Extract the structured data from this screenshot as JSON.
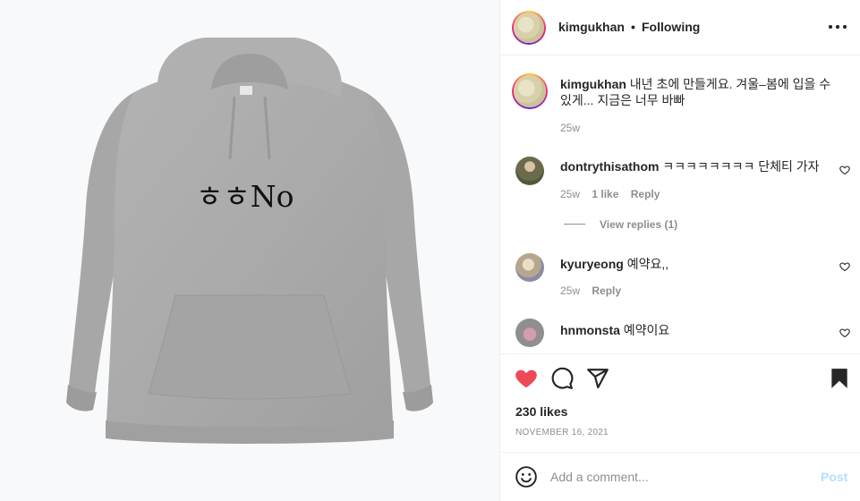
{
  "post": {
    "image_print_text": "ㅎㅎNo",
    "image_alt": "gray-hoodie"
  },
  "header": {
    "username": "kimgukhan",
    "separator": "•",
    "follow_status": "Following",
    "more_icon": "more-horizontal-icon"
  },
  "caption": {
    "username": "kimgukhan",
    "text": "내년 초에 만들게요. 겨울–봄에 입을 수 있게... 지금은 너무 바빠",
    "time": "25w"
  },
  "comments": [
    {
      "username": "dontrythisathom",
      "text": "ㅋㅋㅋㅋㅋㅋㅋㅋ 단체티 가자",
      "time": "25w",
      "likes": "1 like",
      "reply": "Reply",
      "view_replies": "View replies (1)"
    },
    {
      "username": "kyuryeong",
      "text": "예약요,,",
      "time": "25w",
      "reply": "Reply"
    },
    {
      "username": "hnmonsta",
      "text": "예약이요"
    }
  ],
  "actions": {
    "like_icon": "heart-filled-icon",
    "comment_icon": "comment-icon",
    "share_icon": "send-icon",
    "save_icon": "bookmark-filled-icon",
    "likes_count": "230 likes",
    "date": "NOVEMBER 16, 2021",
    "like_color": "#ed4956"
  },
  "add_comment": {
    "emoji_icon": "emoji-icon",
    "placeholder": "Add a comment...",
    "post_label": "Post",
    "post_color": "#b2dffc"
  }
}
